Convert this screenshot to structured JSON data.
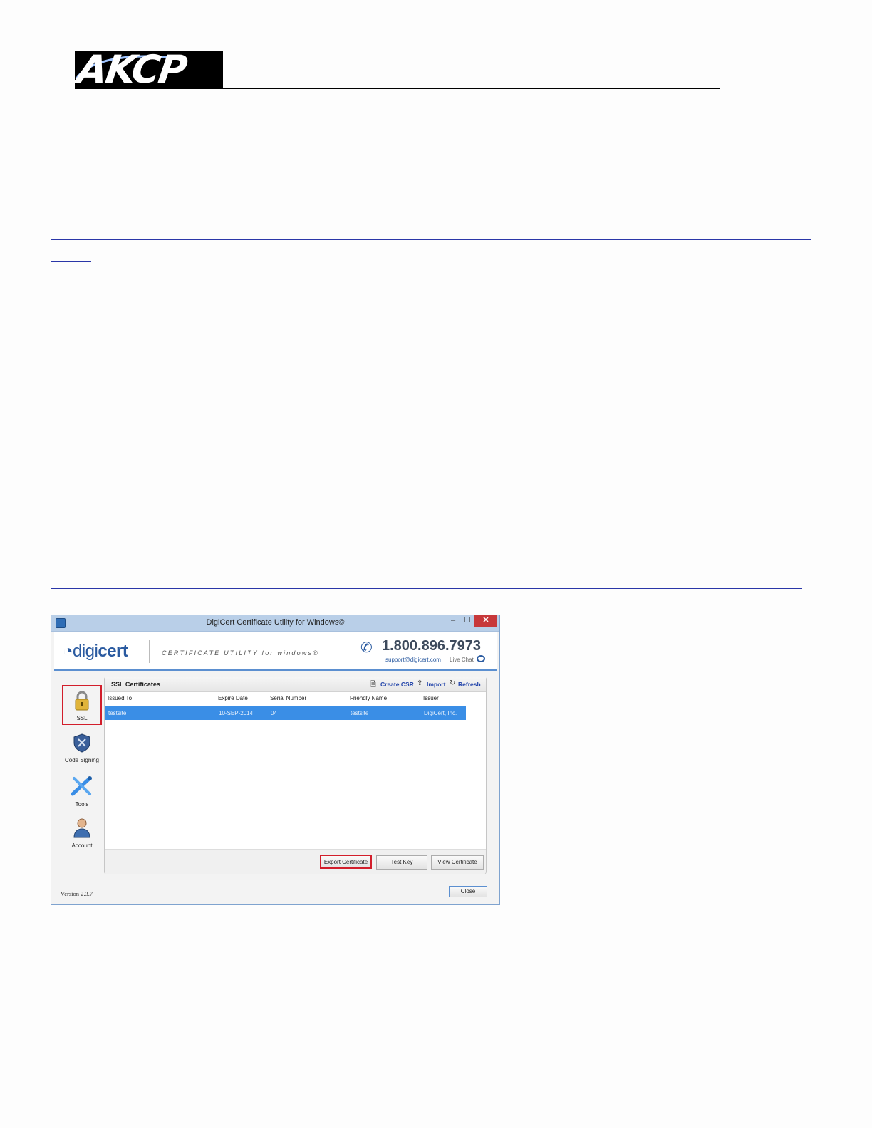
{
  "header": {
    "logo_text": "AKCP"
  },
  "window": {
    "title": "DigiCert Certificate Utility for Windows©",
    "controls": {
      "minimize": "–",
      "maximize": "☐",
      "close": "✕"
    }
  },
  "banner": {
    "logo_light": "digi",
    "logo_bold": "cert",
    "tagline": "CERTIFICATE UTILITY for windows®",
    "phone": "1.800.896.7973",
    "email": "support@digicert.com",
    "live_chat": "Live Chat"
  },
  "sidebar": {
    "items": [
      {
        "label": "SSL",
        "icon": "padlock-icon",
        "selected": true
      },
      {
        "label": "Code Signing",
        "icon": "shield-icon"
      },
      {
        "label": "Tools",
        "icon": "tools-icon"
      },
      {
        "label": "Account",
        "icon": "user-icon"
      }
    ]
  },
  "panel": {
    "title": "SSL Certificates",
    "toolbar": {
      "create_csr": "Create CSR",
      "import": "Import",
      "refresh": "Refresh"
    },
    "columns": [
      "Issued To",
      "Expire Date",
      "Serial Number",
      "Friendly Name",
      "Issuer"
    ],
    "rows": [
      [
        "testsite",
        "10-SEP-2014",
        "04",
        "testsite",
        "DigiCert, Inc."
      ]
    ],
    "buttons": {
      "export": "Export Certificate",
      "test_key": "Test Key",
      "view": "View Certificate"
    }
  },
  "footer": {
    "version": "Version 2.3.7",
    "close": "Close"
  },
  "colors": {
    "accent": "#3a8ee6",
    "highlight": "#d21e2b",
    "link_rule": "#2a36a8"
  }
}
